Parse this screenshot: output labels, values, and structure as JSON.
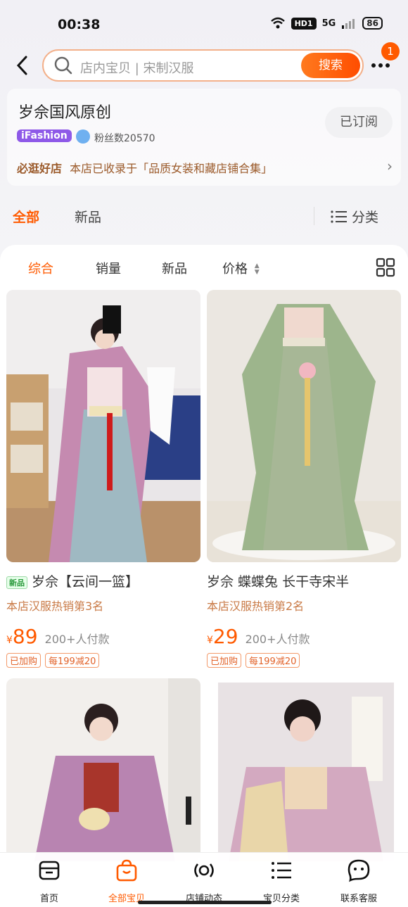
{
  "status_bar": {
    "time": "00:38",
    "network_label": "HD1",
    "signal_label": "5G",
    "battery": "86"
  },
  "top_bar": {
    "search_placeholder": "店内宝贝 | 宋制汉服",
    "search_button": "搜索",
    "more_badge": "1"
  },
  "shop": {
    "name": "岁佘国风原创",
    "ifashion_label": "iFashion",
    "fans": "粉丝数20570",
    "subscribe_button": "已订阅",
    "promo_highlight": "必逛好店",
    "promo_text": "本店已收录于「品质女装和藏店铺合集」"
  },
  "main_tabs": {
    "all": "全部",
    "new": "新品",
    "category": "分类"
  },
  "sort_bar": {
    "comprehensive": "综合",
    "sales": "销量",
    "new": "新品",
    "price": "价格"
  },
  "products": [
    {
      "new_tag": "新品",
      "title": "岁佘【云间一篮】",
      "rank": "本店汉服热销第3名",
      "price": "89",
      "paid": "200+人付款",
      "tags": [
        "已加购",
        "每199减20"
      ]
    },
    {
      "title": "岁佘 蝶蝶兔 长干寺宋半",
      "rank": "本店汉服热销第2名",
      "price": "29",
      "paid": "200+人付款",
      "tags": [
        "已加购",
        "每199减20"
      ]
    }
  ],
  "currency_symbol": "¥",
  "bottom_nav": [
    {
      "label": "首页",
      "icon": "shop-icon"
    },
    {
      "label": "全部宝贝",
      "icon": "bag-icon"
    },
    {
      "label": "店铺动态",
      "icon": "broadcast-icon"
    },
    {
      "label": "宝贝分类",
      "icon": "list-icon"
    },
    {
      "label": "联系客服",
      "icon": "chat-icon"
    }
  ],
  "colors": {
    "accent": "#ff5a00",
    "promo": "#9b5a2a",
    "rank": "#c97a46"
  }
}
